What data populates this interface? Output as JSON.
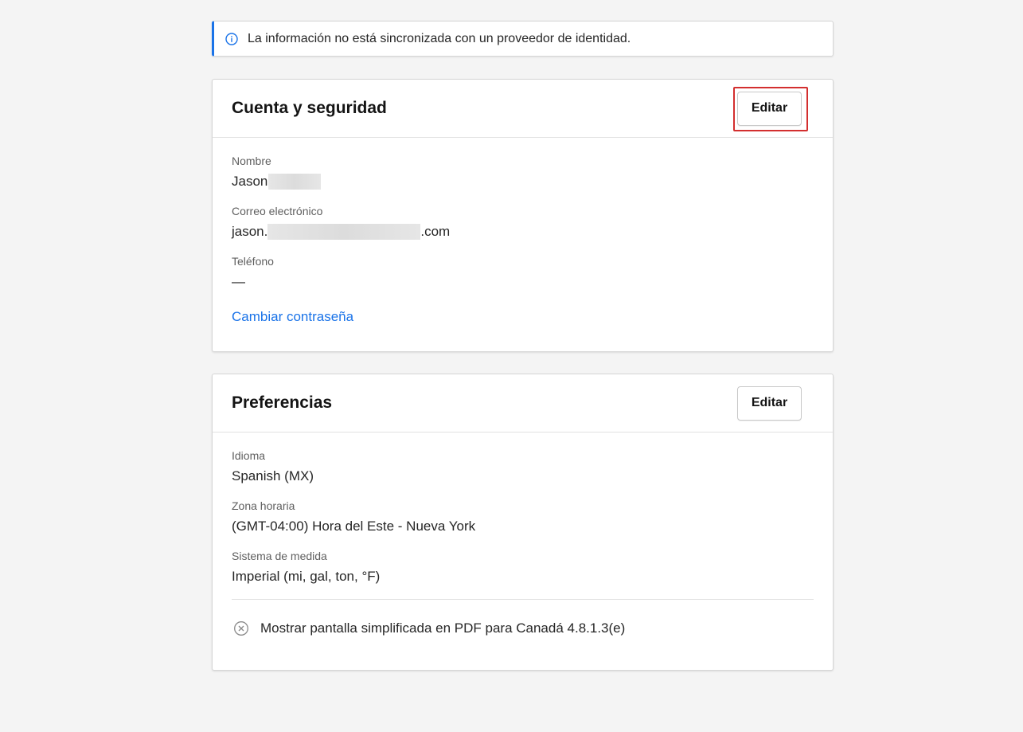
{
  "banner": {
    "icon": "info-icon",
    "text": "La información no está sincronizada con un proveedor de identidad."
  },
  "account": {
    "title": "Cuenta y seguridad",
    "edit_label": "Editar",
    "fields": {
      "name_label": "Nombre",
      "name_value": "Jason",
      "email_label": "Correo electrónico",
      "email_prefix": "jason.",
      "email_suffix": ".com",
      "phone_label": "Teléfono",
      "phone_value": "—"
    },
    "change_password": "Cambiar contraseña"
  },
  "preferences": {
    "title": "Preferencias",
    "edit_label": "Editar",
    "fields": {
      "language_label": "Idioma",
      "language_value": "Spanish (MX)",
      "timezone_label": "Zona horaria",
      "timezone_value": "(GMT-04:00) Hora del Este - Nueva York",
      "units_label": "Sistema de medida",
      "units_value": "Imperial (mi, gal, ton, °F)"
    },
    "toggle": {
      "icon": "x-circle-icon",
      "text": "Mostrar pantalla simplificada en PDF para Canadá 4.8.1.3(e)"
    }
  },
  "colors": {
    "accent": "#1a73e8",
    "highlight": "#d32f2f",
    "background": "#f4f4f4"
  }
}
